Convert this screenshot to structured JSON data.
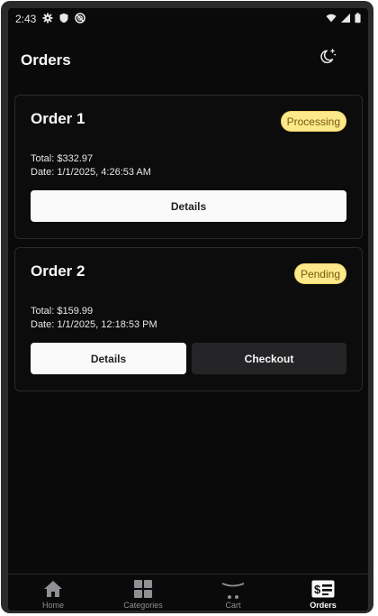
{
  "status_bar": {
    "time": "2:43",
    "left_icons": [
      "gear-icon",
      "shield-icon",
      "sync-icon"
    ],
    "right_icons": [
      "wifi-icon",
      "signal-icon",
      "battery-icon"
    ]
  },
  "header": {
    "title": "Orders",
    "theme_toggle_icon": "moon-icon"
  },
  "orders": [
    {
      "title": "Order 1",
      "status": "Processing",
      "total": "Total: $332.97",
      "date": "Date: 1/1/2025, 4:26:53 AM",
      "details_label": "Details"
    },
    {
      "title": "Order 2",
      "status": "Pending",
      "total": "Total: $159.99",
      "date": "Date: 1/1/2025, 12:18:53 PM",
      "details_label": "Details",
      "checkout_label": "Checkout"
    }
  ],
  "bottom_nav": {
    "items": [
      {
        "label": "Home",
        "icon": "home-icon",
        "active": false
      },
      {
        "label": "Categories",
        "icon": "grid-icon",
        "active": false
      },
      {
        "label": "Cart",
        "icon": "cart-icon",
        "active": false
      },
      {
        "label": "Orders",
        "icon": "receipt-icon",
        "active": true
      }
    ]
  },
  "colors": {
    "background": "#0a0a0b",
    "badge_bg": "#fbe98a",
    "badge_text": "#7a5a0a",
    "button_light": "#fafafa",
    "button_dark": "#252528"
  }
}
